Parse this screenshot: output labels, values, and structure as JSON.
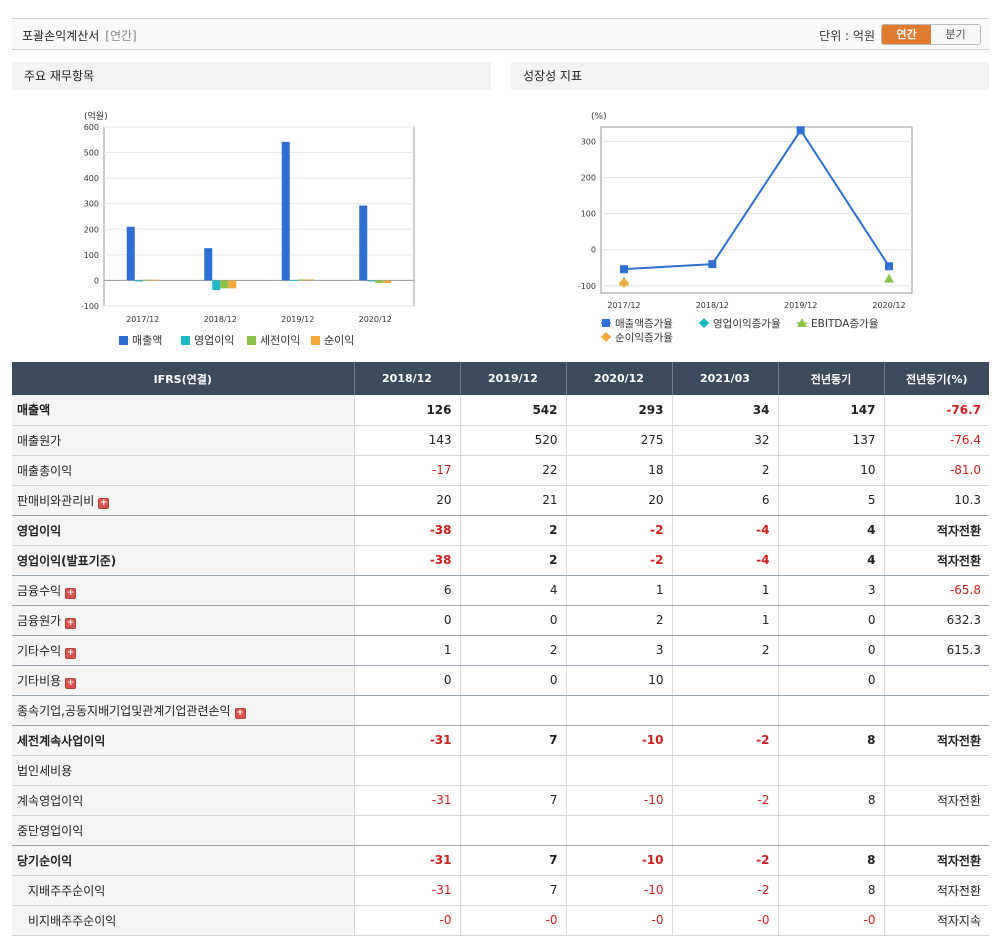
{
  "header": {
    "title": "포괄손익계산서",
    "subtitle": "[연간]",
    "unit_label": "단위 : 억원",
    "toggle_annual": "연간",
    "toggle_quarterly": "분기"
  },
  "panels": {
    "left_title": "주요 재무항목",
    "right_title": "성장성 지표"
  },
  "chart_data": [
    {
      "type": "bar",
      "ylabel": "(억원)",
      "ylim": [
        -100,
        600
      ],
      "yticks": [
        "600",
        "500",
        "400",
        "300",
        "200",
        "100",
        "0",
        "-100"
      ],
      "categories": [
        "2017/12",
        "2018/12",
        "2019/12",
        "2020/12"
      ],
      "series": [
        {
          "name": "매출액",
          "color": "#2e6fd6",
          "values": [
            210,
            126,
            542,
            293
          ]
        },
        {
          "name": "영업이익",
          "color": "#1fb9c6",
          "values": [
            -3,
            -38,
            2,
            -2
          ]
        },
        {
          "name": "세전이익",
          "color": "#8dc24a",
          "values": [
            3,
            -31,
            4,
            -10
          ]
        },
        {
          "name": "순이익",
          "color": "#f3a83a",
          "values": [
            3,
            -31,
            4,
            -10
          ]
        }
      ],
      "grid": true,
      "legend": "bottom"
    },
    {
      "type": "line",
      "ylabel": "(%)",
      "ylim": [
        -120,
        340
      ],
      "yticks": [
        "300",
        "200",
        "100",
        "0",
        "-100"
      ],
      "categories": [
        "2017/12",
        "2018/12",
        "2019/12",
        "2020/12"
      ],
      "series": [
        {
          "name": "매출액증가율",
          "color": "#2e6fd6",
          "marker": "square",
          "values": [
            -54,
            -40,
            331,
            -46
          ]
        },
        {
          "name": "영업이익증가율",
          "color": "#1fb9c6",
          "marker": "diamond",
          "values": []
        },
        {
          "name": "EBITDA증가율",
          "color": "#8dc24a",
          "marker": "triangle",
          "values": [
            -88,
            null,
            null,
            -80
          ]
        },
        {
          "name": "순이익증가율",
          "color": "#f3a83a",
          "marker": "diamond",
          "values": [
            -92,
            null,
            null,
            null
          ]
        }
      ],
      "grid": true,
      "legend": "bottom"
    }
  ],
  "table": {
    "columns": [
      "IFRS(연결)",
      "2018/12",
      "2019/12",
      "2020/12",
      "2021/03",
      "전년동기",
      "전년동기(%)"
    ],
    "rows": [
      {
        "label": "매출액",
        "values": [
          "126",
          "542",
          "293",
          "34",
          "147",
          "-76.7"
        ],
        "bold": true
      },
      {
        "label": "매출원가",
        "values": [
          "143",
          "520",
          "275",
          "32",
          "137",
          "-76.4"
        ]
      },
      {
        "label": "매출총이익",
        "values": [
          "-17",
          "22",
          "18",
          "2",
          "10",
          "-81.0"
        ]
      },
      {
        "label": "판매비와관리비",
        "plus": true,
        "values": [
          "20",
          "21",
          "20",
          "6",
          "5",
          "10.3"
        ],
        "sep": true
      },
      {
        "label": "영업이익",
        "values": [
          "-38",
          "2",
          "-2",
          "-4",
          "4",
          "적자전환"
        ],
        "bold": true
      },
      {
        "label": "영업이익(발표기준)",
        "values": [
          "-38",
          "2",
          "-2",
          "-4",
          "4",
          "적자전환"
        ],
        "bold": true,
        "sep": true
      },
      {
        "label": "금융수익",
        "plus": true,
        "values": [
          "6",
          "4",
          "1",
          "1",
          "3",
          "-65.8"
        ],
        "sep": true
      },
      {
        "label": "금융원가",
        "plus": true,
        "values": [
          "0",
          "0",
          "2",
          "1",
          "0",
          "632.3"
        ],
        "sep": true
      },
      {
        "label": "기타수익",
        "plus": true,
        "values": [
          "1",
          "2",
          "3",
          "2",
          "0",
          "615.3"
        ],
        "sep": true
      },
      {
        "label": "기타비용",
        "plus": true,
        "values": [
          "0",
          "0",
          "10",
          "",
          "0",
          ""
        ],
        "sep": true
      },
      {
        "label": "종속기업,공동지배기업및관계기업관련손익",
        "plus": true,
        "values": [
          "",
          "",
          "",
          "",
          "",
          ""
        ],
        "sep": true
      },
      {
        "label": "세전계속사업이익",
        "values": [
          "-31",
          "7",
          "-10",
          "-2",
          "8",
          "적자전환"
        ],
        "bold": true
      },
      {
        "label": "법인세비용",
        "values": [
          "",
          "",
          "",
          "",
          "",
          ""
        ]
      },
      {
        "label": "계속영업이익",
        "values": [
          "-31",
          "7",
          "-10",
          "-2",
          "8",
          "적자전환"
        ]
      },
      {
        "label": "중단영업이익",
        "values": [
          "",
          "",
          "",
          "",
          "",
          ""
        ],
        "sep": true
      },
      {
        "label": "당기순이익",
        "values": [
          "-31",
          "7",
          "-10",
          "-2",
          "8",
          "적자전환"
        ],
        "bold": true
      },
      {
        "label": "지배주주순이익",
        "indent": true,
        "values": [
          "-31",
          "7",
          "-10",
          "-2",
          "8",
          "적자전환"
        ]
      },
      {
        "label": "비지배주주순이익",
        "indent": true,
        "values": [
          "-0",
          "-0",
          "-0",
          "-0",
          "-0",
          "적자지속"
        ]
      }
    ]
  }
}
